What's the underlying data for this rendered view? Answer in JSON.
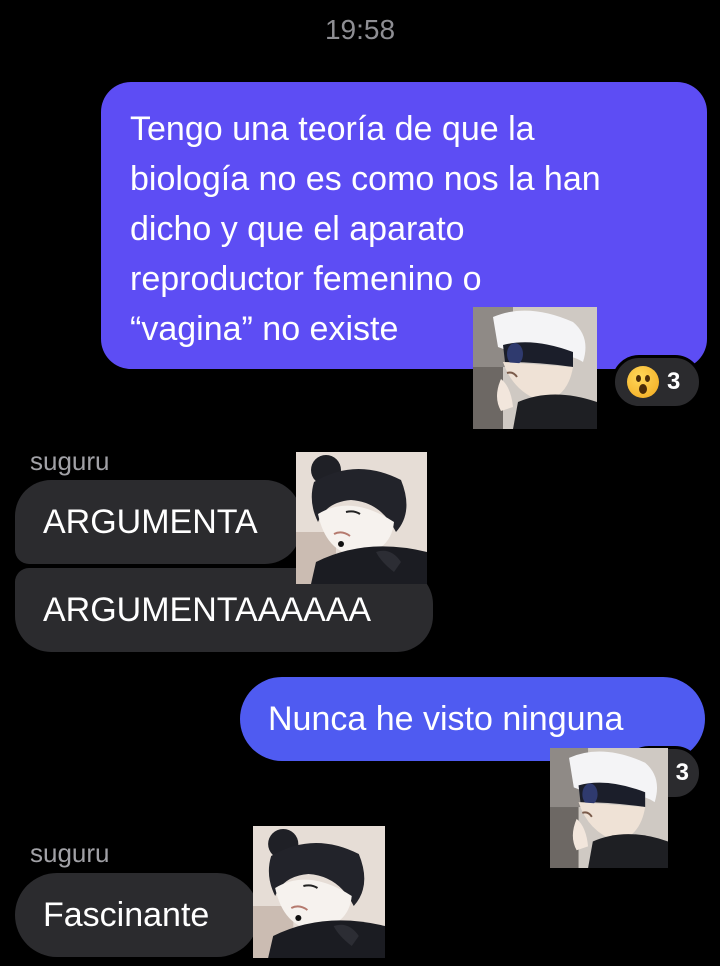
{
  "chat": {
    "timestamp": "19:58",
    "messages": [
      {
        "direction": "outgoing",
        "text": "Tengo una teoría de que la\nbiología no es como nos la han\ndicho y que el aparato\nreproductor femenino o\n“vagina” no existe",
        "reaction": {
          "icon": "astonished-face-emoji",
          "count": "3"
        },
        "read_by_avatar": "gojo-avatar"
      },
      {
        "direction": "incoming",
        "sender": "suguru",
        "text": "ARGUMENTA"
      },
      {
        "direction": "incoming",
        "text": "ARGUMENTAAAAAA",
        "read_by_avatar": "suguru-avatar"
      },
      {
        "direction": "outgoing",
        "text": "Nunca he visto ninguna",
        "reaction": {
          "icon": "laughing-face-emoji",
          "count": "3"
        },
        "read_by_avatar": "gojo-avatar"
      },
      {
        "direction": "incoming",
        "sender": "suguru",
        "text": "Fascinante",
        "read_by_avatar": "suguru-avatar"
      }
    ]
  },
  "colors": {
    "background": "#000000",
    "outgoing_bubble_1": "#5d4df4",
    "outgoing_bubble_2": "#4f5bf1",
    "incoming_bubble": "#2b2b2e",
    "secondary_text": "#a1a1a6"
  }
}
